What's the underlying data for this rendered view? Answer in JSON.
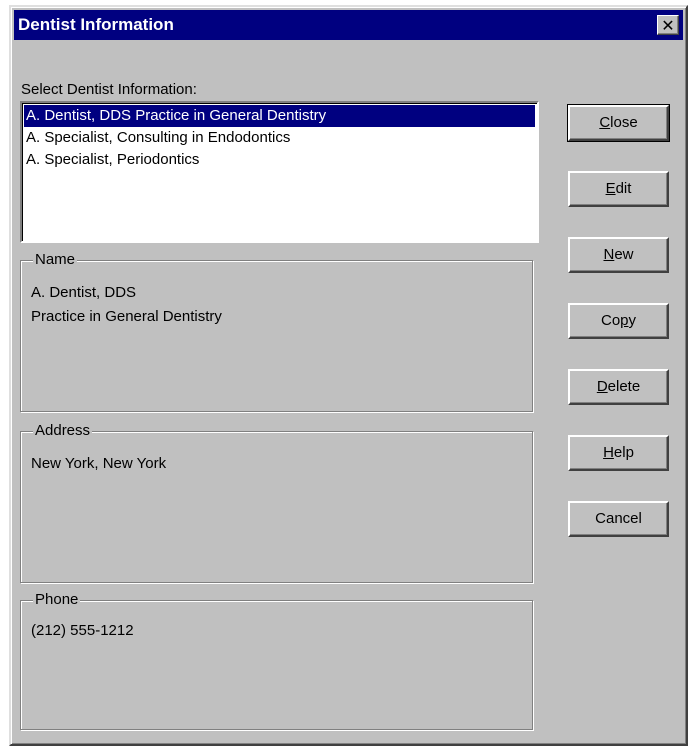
{
  "window": {
    "title": "Dentist Information",
    "close_glyph": "✕"
  },
  "list": {
    "label": "Select Dentist Information:",
    "items": [
      {
        "label": "A. Dentist, DDS Practice in General Dentistry",
        "selected": true
      },
      {
        "label": "A. Specialist, Consulting in Endodontics",
        "selected": false
      },
      {
        "label": "A. Specialist, Periodontics",
        "selected": false
      }
    ]
  },
  "name_group": {
    "title": "Name",
    "line1": "A. Dentist, DDS",
    "line2": "Practice in General Dentistry"
  },
  "address_group": {
    "title": "Address",
    "line1": "New York, New York"
  },
  "phone_group": {
    "title": "Phone",
    "line1": "(212) 555-1212"
  },
  "buttons": {
    "close": {
      "mnemonic": "C",
      "rest": "lose"
    },
    "edit": {
      "mnemonic": "E",
      "rest": "dit"
    },
    "new": {
      "mnemonic": "N",
      "rest": "ew"
    },
    "copy": {
      "pre": "Co",
      "mnemonic": "p",
      "rest": "y"
    },
    "delete": {
      "mnemonic": "D",
      "rest": "elete"
    },
    "help": {
      "mnemonic": "H",
      "rest": "elp"
    },
    "cancel": {
      "label": "Cancel"
    }
  },
  "colors": {
    "titlebar": "#000080",
    "face": "#c0c0c0",
    "selection": "#000080"
  }
}
